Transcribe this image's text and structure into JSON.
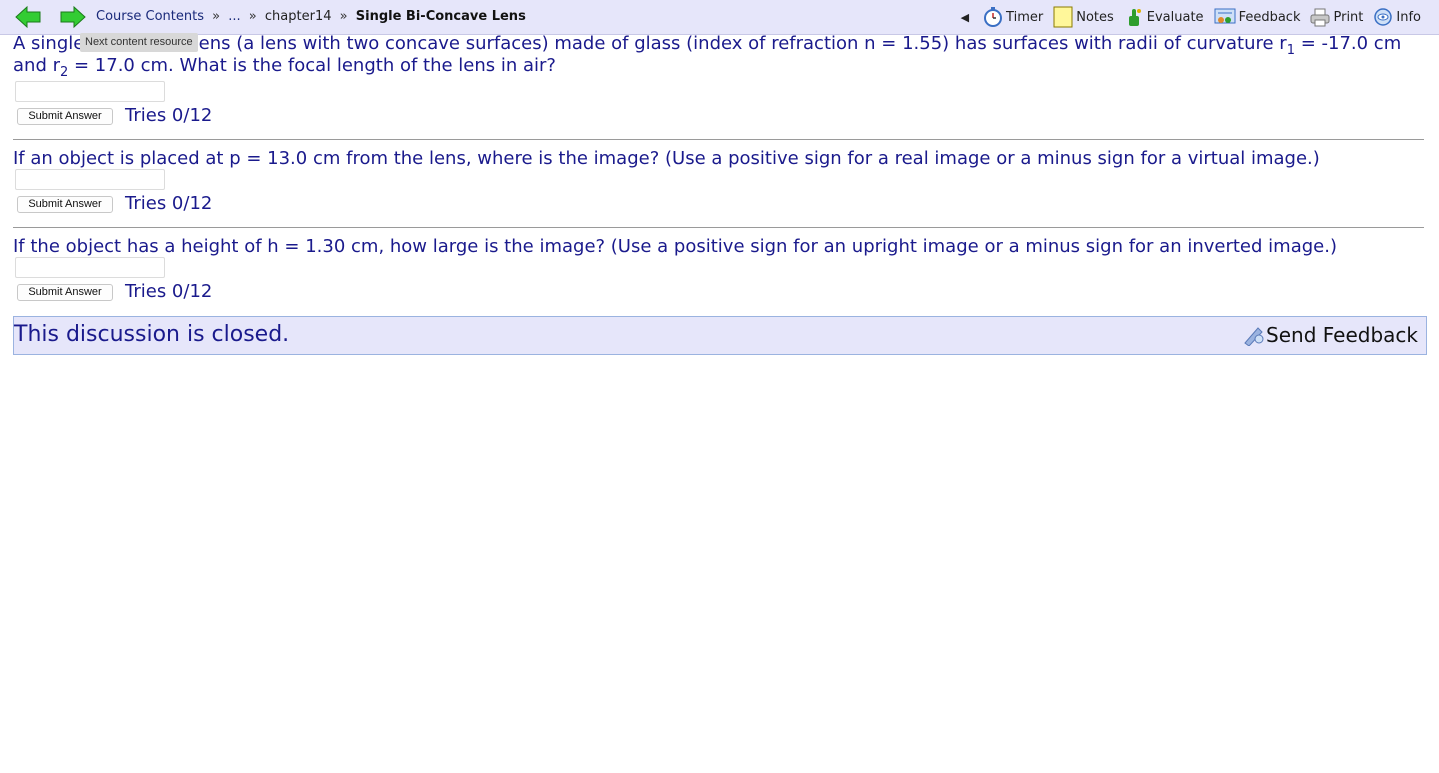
{
  "nav": {
    "breadcrumbs": {
      "course_contents": "Course Contents",
      "sep": "»",
      "ellipsis": "...",
      "chapter": "chapter14",
      "current": "Single Bi-Concave Lens"
    },
    "tooltip": "Next content resource",
    "collapse_glyph": "◀",
    "tools": {
      "timer": "Timer",
      "notes": "Notes",
      "evaluate": "Evaluate",
      "feedback": "Feedback",
      "print": "Print",
      "info": "Info"
    }
  },
  "problem": {
    "q1": {
      "intro": "A single bi-concave lens (a lens with two concave surfaces) made of glass (index of refraction n = 1.55) has surfaces with radii of curvature r",
      "sub1": "1",
      "mid": " = -17.0 cm and r",
      "sub2": "2",
      "end": " = 17.0 cm. What is the focal length of the lens in air?"
    },
    "q2": "If an object is placed at p = 13.0 cm from the lens, where is the image? (Use a positive sign for a real image or a minus sign for a virtual image.)",
    "q3": "If the object has a height of h = 1.30 cm, how large is the image? (Use a positive sign for an upright image or a minus sign for an inverted image.)",
    "submit_label": "Submit Answer",
    "tries": "Tries 0/12",
    "answers": [
      "",
      "",
      ""
    ]
  },
  "discussion": {
    "closed_text": "This discussion is closed.",
    "send_feedback": "Send Feedback"
  },
  "colors": {
    "accent_bg": "#e6e6fa",
    "question_text": "#1a1a8c",
    "arrow_green": "#33cc33"
  },
  "icons": [
    "back-arrow-icon",
    "forward-arrow-icon",
    "timer-icon",
    "notes-icon",
    "evaluate-icon",
    "feedback-icon",
    "print-icon",
    "info-icon",
    "send-feedback-icon"
  ]
}
